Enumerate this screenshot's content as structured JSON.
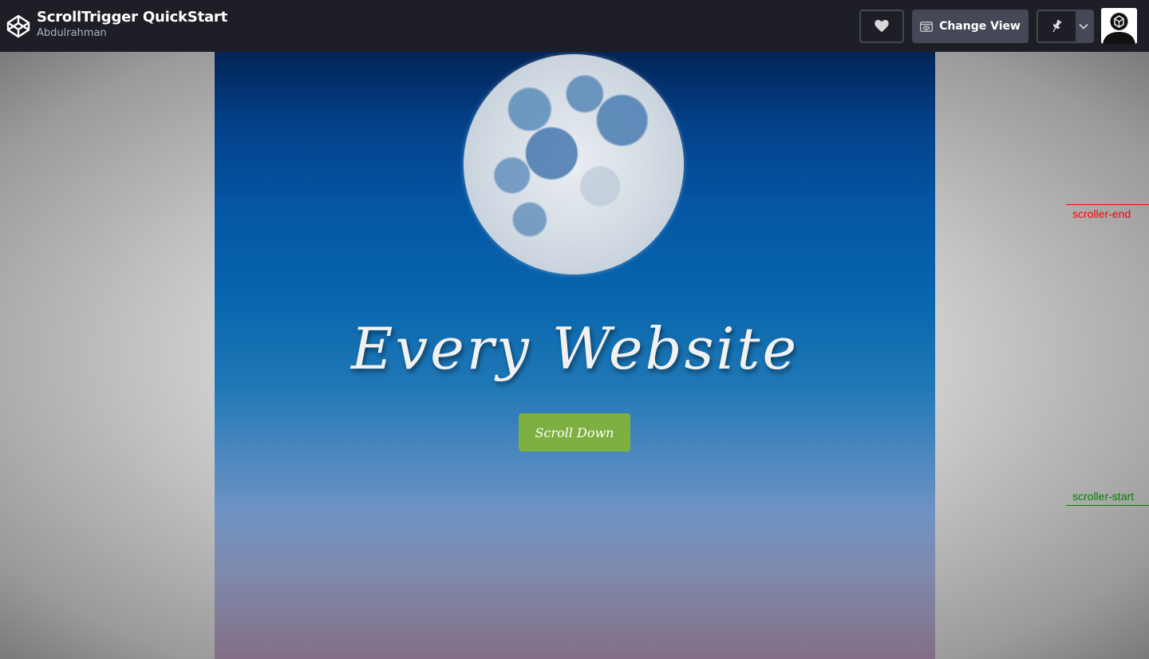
{
  "topbar": {
    "title": "ScrollTrigger QuickStart",
    "author": "Abdulrahman",
    "change_view_label": "Change View",
    "icons": [
      "codepen-logo-icon",
      "heart-icon",
      "eye-icon",
      "pin-icon",
      "chevron-down-icon",
      "avatar"
    ]
  },
  "preview": {
    "hero_title": "Every Website",
    "scroll_button_label": "Scroll Down"
  },
  "markers": {
    "end_label": "scroller-end",
    "start_label": "scroller-start",
    "end_color": "#ff0000",
    "start_color": "#008000"
  },
  "colors": {
    "topbar": "#1e1f26",
    "button_secondary": "#444857",
    "scroll_button": "#7db041"
  }
}
